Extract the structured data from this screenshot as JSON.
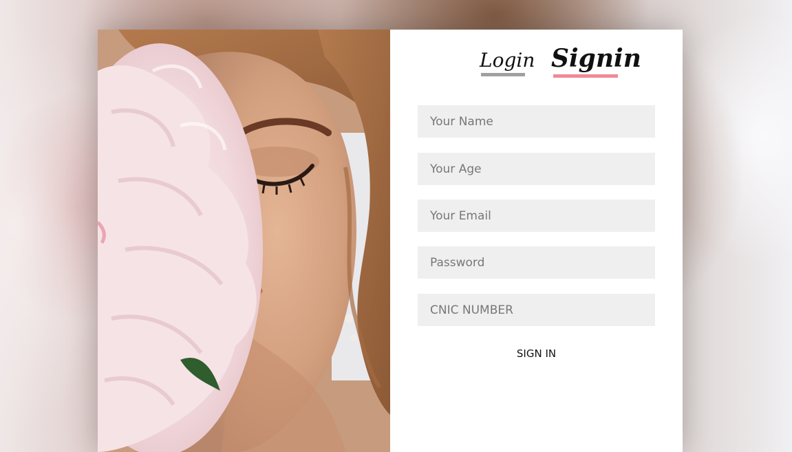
{
  "tabs": {
    "login": {
      "label": "Login",
      "underline_color": "#a0a0a0"
    },
    "signin": {
      "label": "Signin",
      "underline_color": "#f08a94"
    }
  },
  "form": {
    "fields": [
      {
        "placeholder": "Your Name",
        "value": ""
      },
      {
        "placeholder": "Your Age",
        "value": ""
      },
      {
        "placeholder": "Your Email",
        "value": ""
      },
      {
        "placeholder": "Password",
        "value": ""
      },
      {
        "placeholder": "CNIC NUMBER",
        "value": ""
      }
    ],
    "submit_label": "SIGN IN"
  },
  "colors": {
    "field_background": "#efefef",
    "panel_background": "#ffffff",
    "text": "#111111"
  }
}
